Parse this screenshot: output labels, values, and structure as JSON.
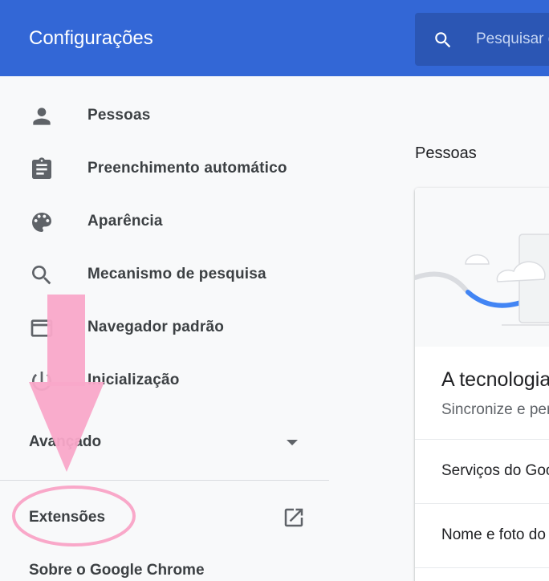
{
  "header": {
    "title": "Configurações",
    "search_placeholder": "Pesquisar configurações",
    "search_icon": "search-icon"
  },
  "sidebar": {
    "items": [
      {
        "label": "Pessoas",
        "icon": "person-icon"
      },
      {
        "label": "Preenchimento automático",
        "icon": "clipboard-icon"
      },
      {
        "label": "Aparência",
        "icon": "palette-icon"
      },
      {
        "label": "Mecanismo de pesquisa",
        "icon": "search-icon"
      },
      {
        "label": "Navegador padrão",
        "icon": "browser-icon"
      },
      {
        "label": "Inicialização",
        "icon": "power-icon"
      }
    ],
    "advanced_label": "Avançado",
    "extensions_label": "Extensões",
    "extensions_icon": "open-in-new-icon",
    "about_label": "Sobre o Google Chrome"
  },
  "main": {
    "section_title": "Pessoas",
    "promo_title": "A tecnologia do Google",
    "promo_subtitle": "Sincronize e personalize",
    "rows": [
      {
        "label": "Serviços do Google"
      },
      {
        "label": "Nome e foto do Chrome"
      }
    ]
  },
  "colors": {
    "header": "#3367d6",
    "search_bg": "#2b56b4",
    "annotation": "#f9a8c9"
  }
}
